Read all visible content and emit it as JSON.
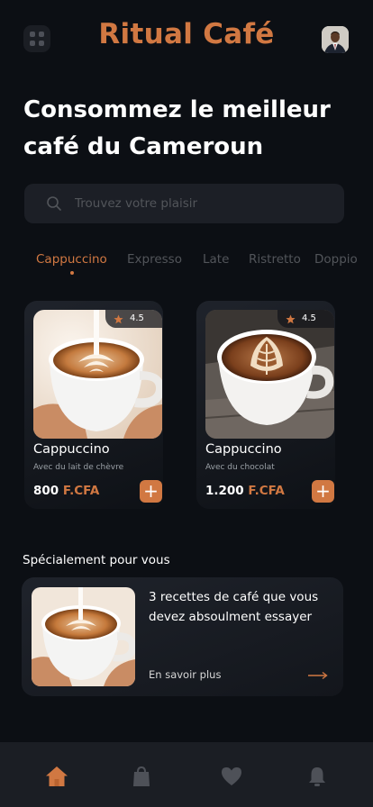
{
  "app": {
    "title": "Ritual Café"
  },
  "hero": {
    "line1": "Consommez le meilleur",
    "line2": "café du Cameroun"
  },
  "search": {
    "placeholder": "Trouvez votre plaisir"
  },
  "categories": [
    "Cappuccino",
    "Expresso",
    "Late",
    "Ristretto",
    "Doppio"
  ],
  "active_category": "Cappuccino",
  "products": [
    {
      "rating": "4.5",
      "name": "Cappuccino",
      "description": "Avec du lait de chèvre",
      "price": "800",
      "currency": "F.CFA"
    },
    {
      "rating": "4.5",
      "name": "Cappuccino",
      "description": "Avec du chocolat",
      "price": "1.200",
      "currency": "F.CFA"
    }
  ],
  "special": {
    "section_title": "Spécialement pour vous",
    "line1": "3 recettes de café que vous",
    "line2": "devez absoulment essayer",
    "link": "En savoir plus"
  },
  "nav": [
    {
      "icon": "home-icon",
      "active": true
    },
    {
      "icon": "bag-icon",
      "active": false
    },
    {
      "icon": "heart-icon",
      "active": false
    },
    {
      "icon": "bell-icon",
      "active": false
    }
  ],
  "colors": {
    "accent": "#d17842",
    "background": "#0c0f14",
    "surface": "#1c1f26",
    "muted": "#52555a",
    "nav_inactive": "#4e5158"
  }
}
